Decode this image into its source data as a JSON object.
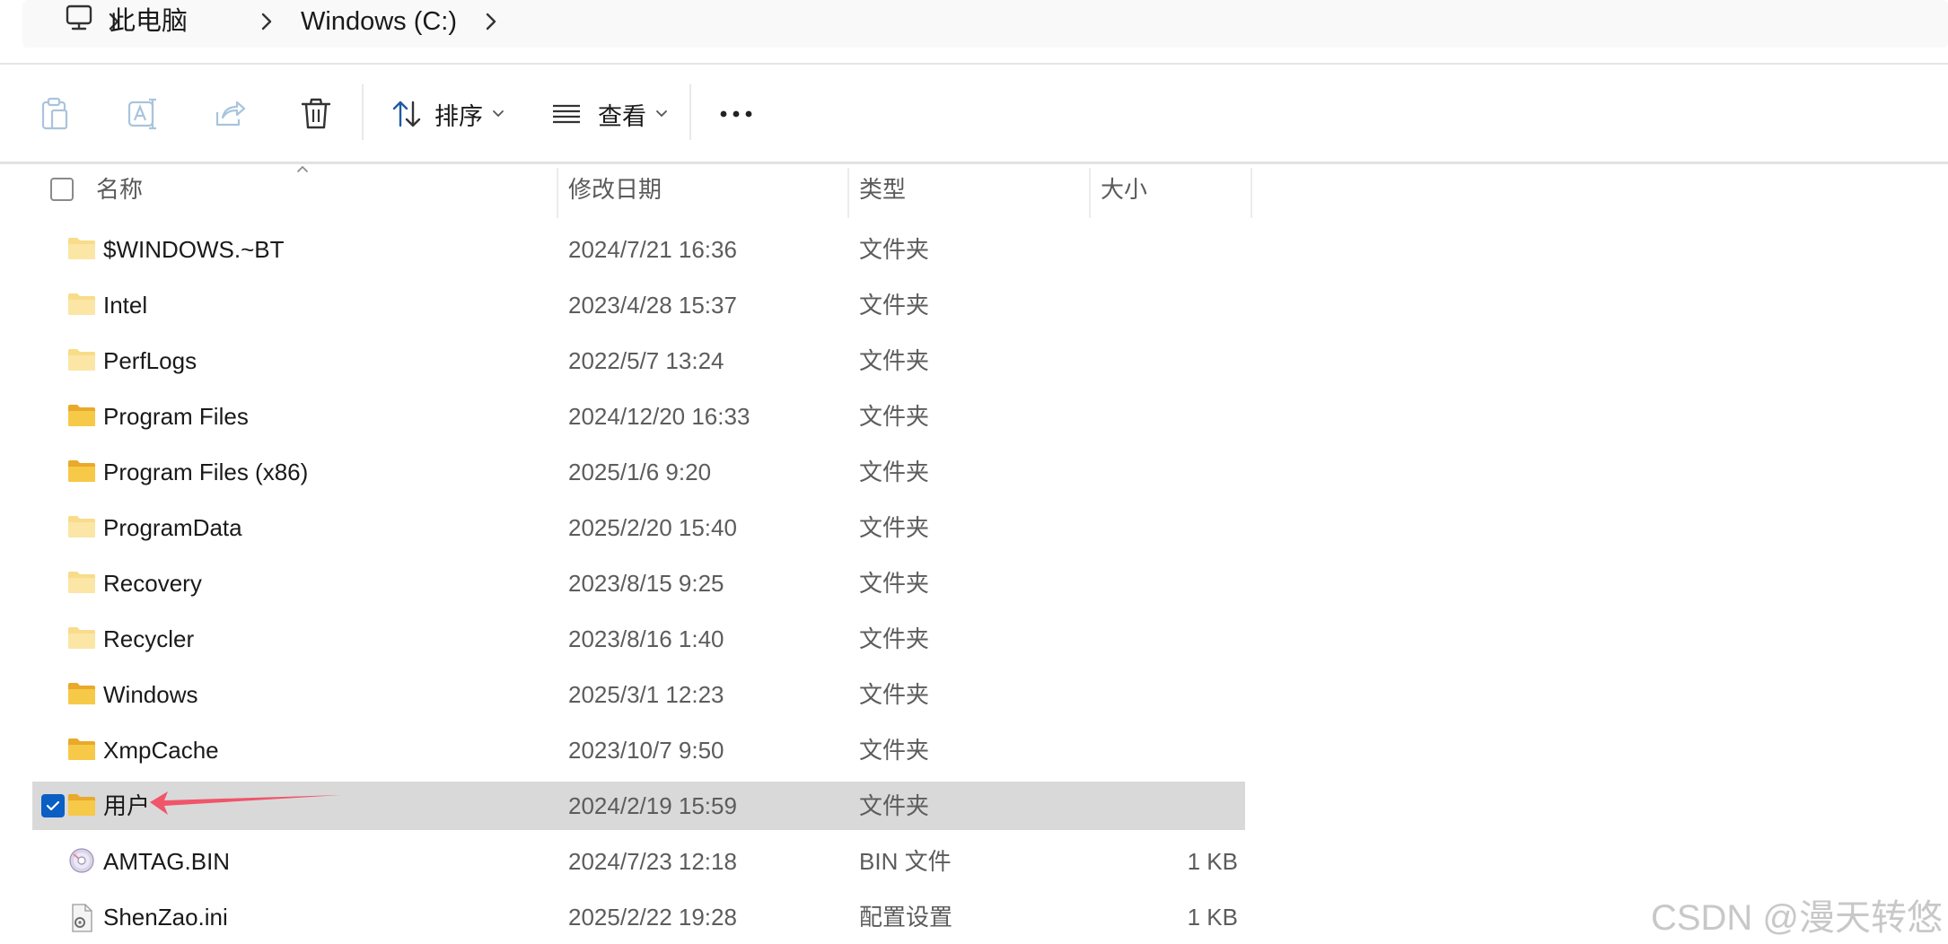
{
  "breadcrumb": {
    "items": [
      "此电脑",
      "Windows (C:)"
    ]
  },
  "toolbar": {
    "copy_icon": "clipboard-icon",
    "rename_icon": "rename-icon",
    "share_icon": "share-icon",
    "delete_icon": "trash-icon",
    "sort_label": "排序",
    "view_label": "查看",
    "more_label": "•••"
  },
  "columns": {
    "name": "名称",
    "modified": "修改日期",
    "type": "类型",
    "size": "大小"
  },
  "files": [
    {
      "name": "$WINDOWS.~BT",
      "modified": "2024/7/21 16:36",
      "type": "文件夹",
      "size": "",
      "icon": "folder-pale-icon"
    },
    {
      "name": "Intel",
      "modified": "2023/4/28 15:37",
      "type": "文件夹",
      "size": "",
      "icon": "folder-pale-icon"
    },
    {
      "name": "PerfLogs",
      "modified": "2022/5/7 13:24",
      "type": "文件夹",
      "size": "",
      "icon": "folder-pale-icon"
    },
    {
      "name": "Program Files",
      "modified": "2024/12/20 16:33",
      "type": "文件夹",
      "size": "",
      "icon": "folder-icon"
    },
    {
      "name": "Program Files (x86)",
      "modified": "2025/1/6 9:20",
      "type": "文件夹",
      "size": "",
      "icon": "folder-icon"
    },
    {
      "name": "ProgramData",
      "modified": "2025/2/20 15:40",
      "type": "文件夹",
      "size": "",
      "icon": "folder-pale-icon"
    },
    {
      "name": "Recovery",
      "modified": "2023/8/15 9:25",
      "type": "文件夹",
      "size": "",
      "icon": "folder-pale-icon"
    },
    {
      "name": "Recycler",
      "modified": "2023/8/16 1:40",
      "type": "文件夹",
      "size": "",
      "icon": "folder-pale-icon"
    },
    {
      "name": "Windows",
      "modified": "2025/3/1 12:23",
      "type": "文件夹",
      "size": "",
      "icon": "folder-icon"
    },
    {
      "name": "XmpCache",
      "modified": "2023/10/7 9:50",
      "type": "文件夹",
      "size": "",
      "icon": "folder-icon"
    },
    {
      "name": "用户",
      "modified": "2024/2/19 15:59",
      "type": "文件夹",
      "size": "",
      "icon": "folder-icon",
      "selected": true
    },
    {
      "name": "AMTAG.BIN",
      "modified": "2024/7/23 12:18",
      "type": "BIN 文件",
      "size": "1 KB",
      "icon": "disc-file-icon"
    },
    {
      "name": "ShenZao.ini",
      "modified": "2025/2/22 19:28",
      "type": "配置设置",
      "size": "1 KB",
      "icon": "settings-file-icon"
    }
  ],
  "colors": {
    "selected_row": "#d9d9d9",
    "checkbox_accent": "#0a5ec4",
    "folder_yellow": "#f5c542",
    "annotation_arrow": "#f0556a"
  },
  "watermark": "CSDN @漫天转悠"
}
